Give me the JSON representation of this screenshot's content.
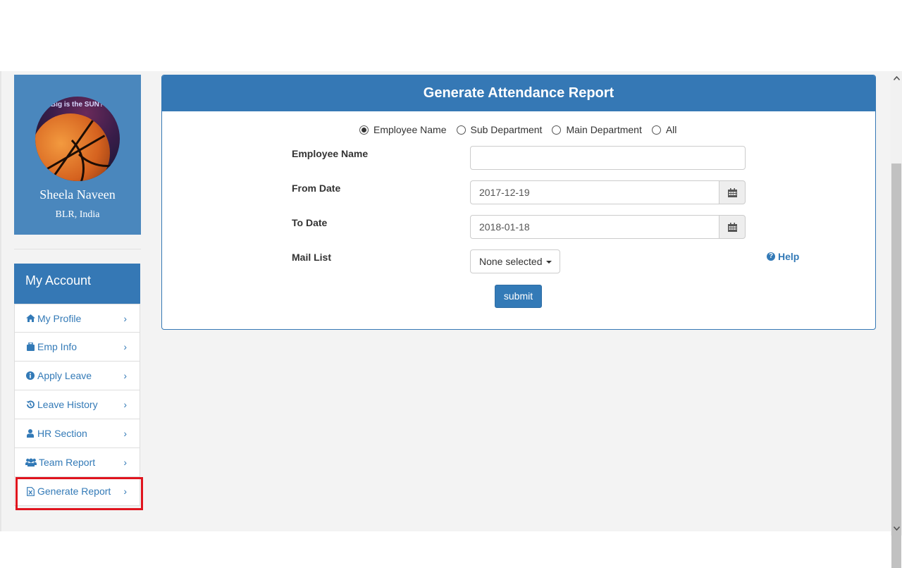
{
  "profile": {
    "name": "Sheela Naveen",
    "location": "BLR, India",
    "avatar_text": "Big is the SUN?"
  },
  "account": {
    "title": "My Account",
    "items": [
      {
        "label": "My Profile",
        "icon": "home-icon"
      },
      {
        "label": "Emp Info",
        "icon": "briefcase-icon"
      },
      {
        "label": "Apply Leave",
        "icon": "info-circle-icon"
      },
      {
        "label": "Leave History",
        "icon": "history-icon"
      },
      {
        "label": "HR Section",
        "icon": "user-icon"
      },
      {
        "label": "Team Report",
        "icon": "users-icon"
      },
      {
        "label": "Generate Report",
        "icon": "file-excel-icon"
      }
    ]
  },
  "report": {
    "title": "Generate Attendance Report",
    "radio_options": [
      "Employee Name",
      "Sub Department",
      "Main Department",
      "All"
    ],
    "selected_radio": "Employee Name",
    "employee_name_label": "Employee Name",
    "employee_name_value": "",
    "from_date_label": "From Date",
    "from_date_value": "2017-12-19",
    "to_date_label": "To Date",
    "to_date_value": "2018-01-18",
    "mail_list_label": "Mail List",
    "mail_list_value": "None selected",
    "help_label": "Help",
    "submit_label": "submit"
  },
  "colors": {
    "primary": "#3578b5",
    "link": "#337ab7",
    "highlight": "#e0141e"
  }
}
